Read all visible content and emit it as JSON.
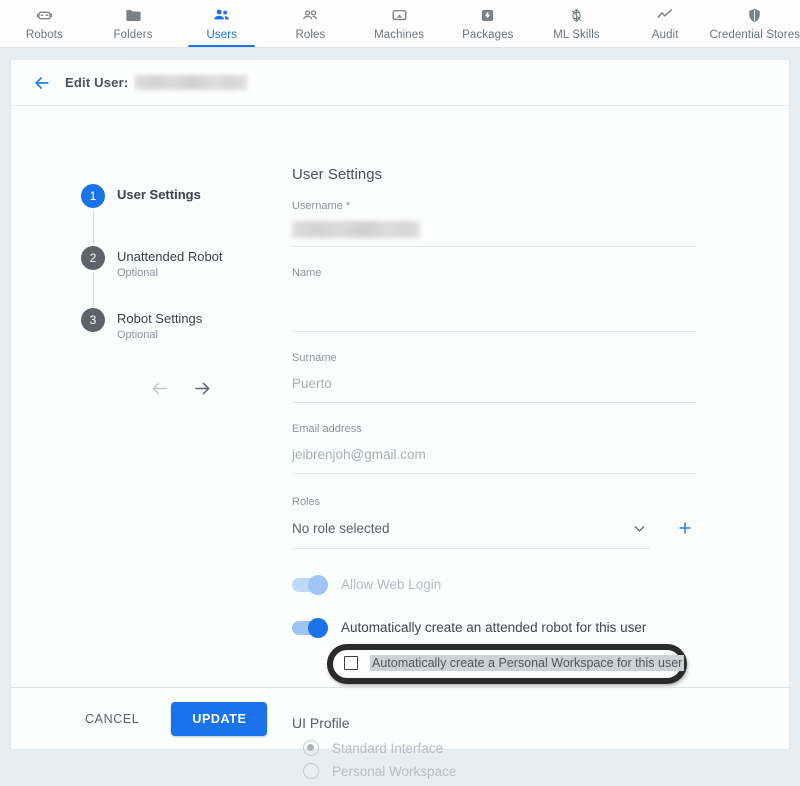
{
  "topnav": {
    "items": [
      {
        "label": "Robots",
        "icon": "robot-icon",
        "active": false
      },
      {
        "label": "Folders",
        "icon": "folder-icon",
        "active": false
      },
      {
        "label": "Users",
        "icon": "users-icon",
        "active": true
      },
      {
        "label": "Roles",
        "icon": "roles-icon",
        "active": false
      },
      {
        "label": "Machines",
        "icon": "machine-icon",
        "active": false
      },
      {
        "label": "Packages",
        "icon": "package-icon",
        "active": false
      },
      {
        "label": "ML Skills",
        "icon": "ml-skills-icon",
        "active": false
      },
      {
        "label": "Audit",
        "icon": "audit-icon",
        "active": false
      },
      {
        "label": "Credential Stores",
        "icon": "credential-stores-icon",
        "active": false
      }
    ],
    "active_color": "#1a73e8"
  },
  "header": {
    "back_icon": "back-arrow-icon",
    "title": "Edit User:",
    "username_redacted": true
  },
  "stepper": {
    "steps": [
      {
        "number": "1",
        "title": "User Settings",
        "subtitle": "",
        "active": true
      },
      {
        "number": "2",
        "title": "Unattended Robot",
        "subtitle": "Optional",
        "active": false
      },
      {
        "number": "3",
        "title": "Robot Settings",
        "subtitle": "Optional",
        "active": false
      }
    ],
    "prev_icon": "arrow-left-icon",
    "next_icon": "arrow-right-icon"
  },
  "form": {
    "section_title": "User Settings",
    "fields": [
      {
        "label": "Username *",
        "value": "",
        "redacted": true
      },
      {
        "label": "Name",
        "value": "",
        "redacted": false
      },
      {
        "label": "Surname",
        "value": "Puerto",
        "redacted": false
      },
      {
        "label": "Email address",
        "value": "jeibrenjoh@gmail.com",
        "redacted": false
      }
    ],
    "roles": {
      "label": "Roles",
      "value": "No role selected",
      "chevron_icon": "chevron-down-icon",
      "add_icon": "plus-icon"
    },
    "toggles": [
      {
        "label": "Allow Web Login",
        "state": "on-disabled"
      },
      {
        "label": "Automatically create an attended robot for this user",
        "state": "on"
      }
    ],
    "checkbox": {
      "label": "Automatically create a Personal Workspace for this user",
      "checked": false,
      "highlighted": true
    },
    "ui_profile": {
      "title": "UI Profile",
      "options": [
        {
          "label": "Standard Interface",
          "selected": true
        },
        {
          "label": "Personal Workspace",
          "selected": false
        }
      ]
    }
  },
  "footer": {
    "cancel_label": "CANCEL",
    "update_label": "UPDATE",
    "update_color": "#1a73e8"
  }
}
